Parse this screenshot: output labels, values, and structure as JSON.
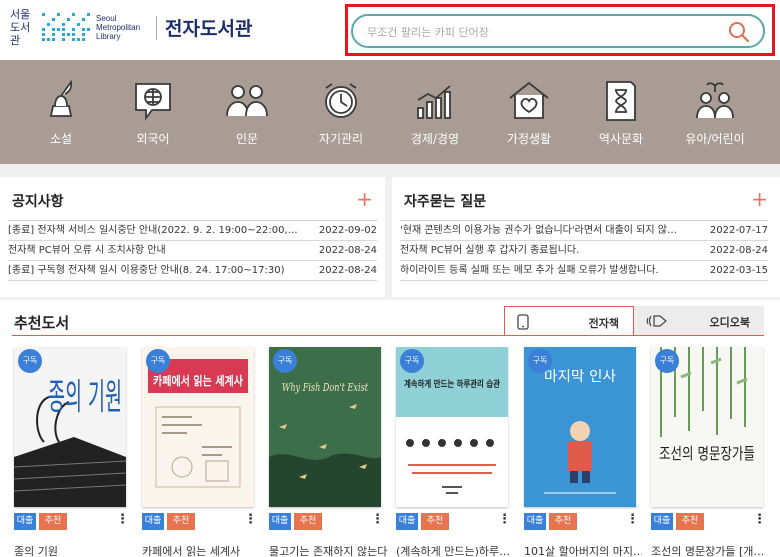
{
  "header": {
    "logo_seoul": "서울\n도서관",
    "logo_english": "Seoul\nMetropolitan\nLibrary",
    "site_title": "전자도서관"
  },
  "search": {
    "placeholder": "무조건 팔리는 카피 단어장",
    "icon": "search-icon"
  },
  "categories": [
    {
      "label": "소설",
      "icon": "quill-pen-icon"
    },
    {
      "label": "외국어",
      "icon": "globe-chat-icon"
    },
    {
      "label": "인문",
      "icon": "people-icon"
    },
    {
      "label": "자기관리",
      "icon": "alarm-clock-icon"
    },
    {
      "label": "경제/경영",
      "icon": "growth-chart-icon"
    },
    {
      "label": "가정생활",
      "icon": "house-heart-icon"
    },
    {
      "label": "역사문화",
      "icon": "hourglass-scroll-icon"
    },
    {
      "label": "유아/어린이",
      "icon": "children-icon"
    }
  ],
  "notices": {
    "title": "공지사항",
    "more": "+",
    "items": [
      {
        "title": "[종료] 전자책 서비스 일시중단 안내(2022. 9. 2. 19:00~22:00, …",
        "date": "2022-09-02"
      },
      {
        "title": "전자책 PC뷰어 오류 시 조치사항 안내",
        "date": "2022-08-24"
      },
      {
        "title": "[종료] 구독형 전자책 일시 이용중단 안내(8. 24. 17:00~17:30)",
        "date": "2022-08-24"
      }
    ]
  },
  "faq": {
    "title": "자주묻는 질문",
    "more": "+",
    "items": [
      {
        "title": "'현재 콘텐츠의 이용가능 권수가 없습니다'라면서 대출이 되지 않…",
        "date": "2022-07-17"
      },
      {
        "title": "전자책 PC뷰어 실행 후 갑자기 종료됩니다.",
        "date": "2022-08-24"
      },
      {
        "title": "하이라이트 등록 실패 또는 메모 추가 실패 오류가 발생합니다.",
        "date": "2022-03-15"
      }
    ]
  },
  "recommended": {
    "title": "추천도서",
    "tabs": [
      {
        "label": "전자책",
        "icon": "tablet-icon",
        "active": true
      },
      {
        "label": "오디오북",
        "icon": "audio-speaker-icon",
        "active": false
      }
    ],
    "badge_label": "구독",
    "loan_label": "대출",
    "recommend_label": "추천",
    "more_label": "⋮",
    "books": [
      {
        "title": "종의 기원",
        "cover_text": "종의 기원"
      },
      {
        "title": "카페에서 읽는 세계사",
        "cover_text": "카페에서 읽는 세계사"
      },
      {
        "title": "물고기는 존재하지 않는다",
        "cover_text": "Why Fish Don't Exist"
      },
      {
        "title": "(계속하게 만드는)하루…",
        "cover_text": "계속하게 만드는 하루관리 습관"
      },
      {
        "title": "101살 할아버지의 마지…",
        "cover_text": "마지막 인사"
      },
      {
        "title": "조선의 명문장가들 [개…",
        "cover_text": "조선의 명문장가들"
      }
    ]
  },
  "colors": {
    "band": "#a89c94",
    "accent": "#e05d4e",
    "plus": "#e8735c",
    "loan_button": "#3a7fd8",
    "recommend_button": "#e8734f",
    "search_border": "#5aa8a8",
    "highlight_box": "#e8151c",
    "brand_navy": "#1c2f6b"
  }
}
